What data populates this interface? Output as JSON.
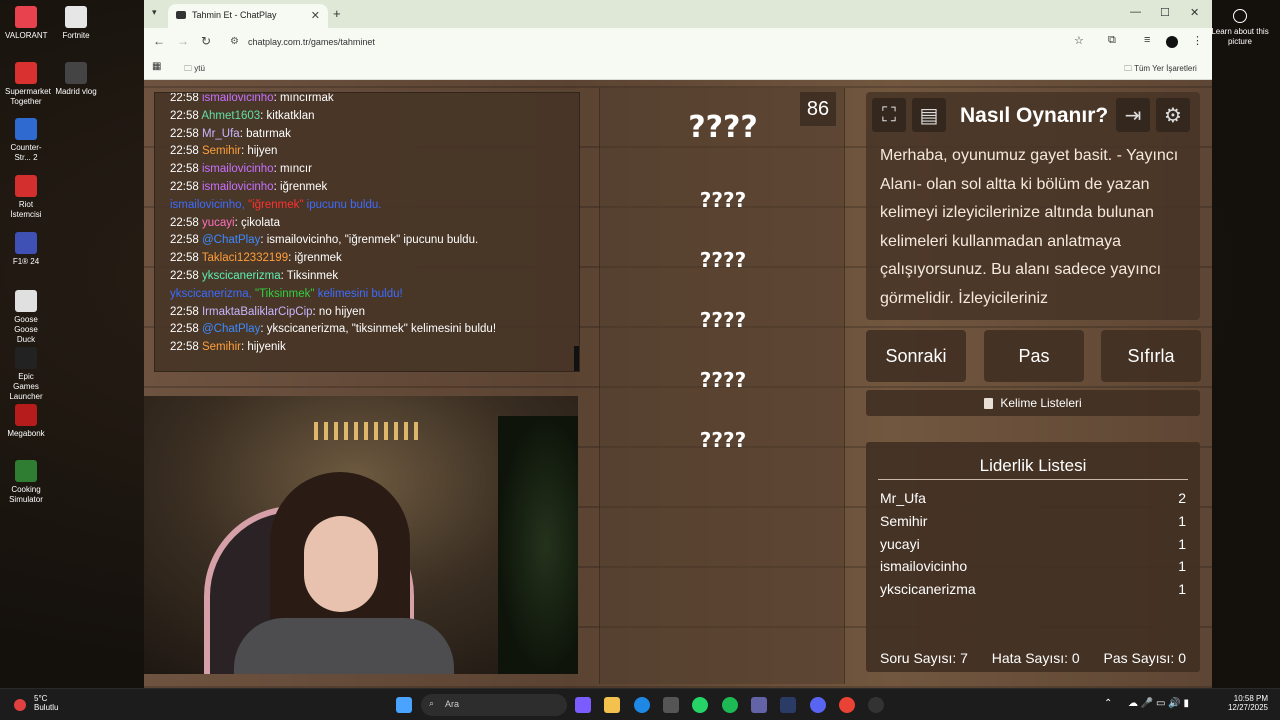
{
  "desktop": {
    "icons": [
      {
        "label": "VALORANT",
        "icon": "valorant-icon",
        "color": "#e8424f"
      },
      {
        "label": "Fortnite",
        "icon": "fortnite-icon",
        "color": "#e6e6e6"
      },
      {
        "label": "Supermarket Together",
        "icon": "supermarket-icon",
        "color": "#d93030"
      },
      {
        "label": "Madrid vlog",
        "icon": "video-file-icon",
        "color": "#444444"
      },
      {
        "label": "Counter-Str... 2",
        "icon": "counter-strike-icon",
        "color": "#2f6ad1"
      },
      {
        "label": "Riot İstemcisi",
        "icon": "riot-icon",
        "color": "#d32f2f"
      },
      {
        "label": "F1® 24",
        "icon": "f1-icon",
        "color": "#3f51b5"
      },
      {
        "label": "Goose Goose Duck",
        "icon": "goose-icon",
        "color": "#e0e0e0"
      },
      {
        "label": "Epic Games Launcher",
        "icon": "epic-icon",
        "color": "#222222"
      },
      {
        "label": "Megabonk",
        "icon": "megabonk-icon",
        "color": "#b71c1c"
      },
      {
        "label": "Cooking Simulator",
        "icon": "cooking-icon",
        "color": "#2e7d32"
      }
    ],
    "learn_about": "Learn about this picture"
  },
  "browser": {
    "tab_title": "Tahmin Et - ChatPlay",
    "url": "chatplay.com.tr/games/tahminet",
    "bookmark_folder": "ytü",
    "all_bookmarks": "Tüm Yer İşaretleri"
  },
  "chat": {
    "lines": [
      {
        "time": "22:58",
        "user": "ismailovicinho",
        "color": "u-purple",
        "msg": ": mıncırmak"
      },
      {
        "time": "22:58",
        "user": "Ahmet1603",
        "color": "u-green",
        "msg": ": kitkatklan"
      },
      {
        "time": "22:58",
        "user": "Mr_Ufa",
        "color": "u-lilac",
        "msg": ": batırmak"
      },
      {
        "time": "22:58",
        "user": "Semihir",
        "color": "u-orange",
        "msg": ": hijyen"
      },
      {
        "time": "22:58",
        "user": "ismailovicinho",
        "color": "u-purple",
        "msg": ": mıncır"
      },
      {
        "time": "22:58",
        "user": "ismailovicinho",
        "color": "u-purple",
        "msg": ": iğrenmek"
      },
      {
        "sys": true,
        "pre": "ismailovicinho, ",
        "hl": "\"iğrenmek\"",
        "hlc": "hl-red",
        "post": " ipucunu buldu."
      },
      {
        "time": "22:58",
        "user": "yucayi",
        "color": "u-pink",
        "msg": ": çikolata"
      },
      {
        "time": "22:58",
        "user": "@ChatPlay",
        "color": "u-blue",
        "msg": ": ismailovicinho, \"iğrenmek\" ipucunu buldu."
      },
      {
        "time": "22:58",
        "user": "Taklaci12332199",
        "color": "u-orange",
        "msg": ": iğrenmek"
      },
      {
        "time": "22:58",
        "user": "ykscicanerizma",
        "color": "u-mint",
        "msg": ": Tiksinmek"
      },
      {
        "sys": true,
        "pre": "ykscicanerizma, ",
        "hl": "\"Tiksinmek\"",
        "hlc": "hl-green",
        "post": " kelimesini buldu!"
      },
      {
        "time": "22:58",
        "user": "IrmaktaBaliklarCipCip",
        "color": "u-lilac",
        "msg": ": no hijyen"
      },
      {
        "time": "22:58",
        "user": "@ChatPlay",
        "color": "u-blue",
        "msg": ": ykscicanerizma, \"tiksinmek\" kelimesini buldu!"
      },
      {
        "time": "22:58",
        "user": "Semihir",
        "color": "u-orange",
        "msg": ": hijyenik"
      }
    ]
  },
  "game": {
    "counter": "86",
    "words": [
      "????",
      "????",
      "????",
      "????",
      "????",
      "????"
    ],
    "howto_title": "Nasıl Oynanır?",
    "howto_text": "Merhaba, oyunumuz gayet basit. - Yayıncı Alanı- olan sol altta ki bölüm de yazan kelimeyi izleyicilerinize altında bulunan kelimeleri kullanmadan anlatmaya çalışıyorsunuz. Bu alanı sadece yayıncı görmelidir. İzleyicileriniz",
    "buttons": {
      "next": "Sonraki",
      "pass": "Pas",
      "reset": "Sıfırla"
    },
    "word_lists": "Kelime Listeleri",
    "leaderboard_title": "Liderlik Listesi",
    "leaderboard": [
      {
        "name": "Mr_Ufa",
        "score": "2"
      },
      {
        "name": "Semihir",
        "score": "1"
      },
      {
        "name": "yucayi",
        "score": "1"
      },
      {
        "name": "ismailovicinho",
        "score": "1"
      },
      {
        "name": "ykscicanerizma",
        "score": "1"
      }
    ],
    "stats": {
      "questions": "Soru Sayısı: 7",
      "errors": "Hata Sayısı: 0",
      "passes": "Pas Sayısı: 0"
    }
  },
  "taskbar": {
    "weather_temp": "5°C",
    "weather_desc": "Bulutlu",
    "search_placeholder": "Ara",
    "time": "10:58 PM",
    "date": "12/27/2025"
  }
}
